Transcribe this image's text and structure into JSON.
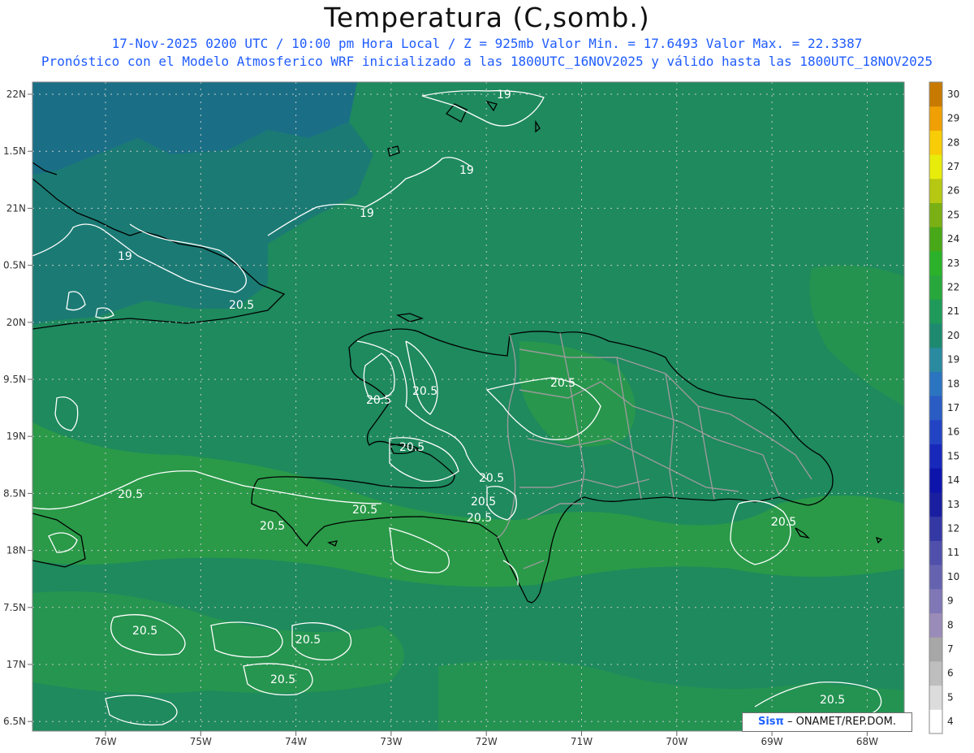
{
  "header": {
    "title": "Temperatura (C,somb.)",
    "line1": "17-Nov-2025  0200 UTC / 10:00 pm Hora Local / Z = 925mb   Valor Min. = 17.6493  Valor Max. = 22.3387",
    "line2": "Pronóstico con el Modelo Atmosferico WRF inicializado a las 1800UTC_16NOV2025 y válido hasta las  1800UTC_18NOV2025"
  },
  "map": {
    "lat_labels": [
      "22N",
      "1.5N",
      "21N",
      "0.5N",
      "20N",
      "9.5N",
      "19N",
      "8.5N",
      "18N",
      "7.5N",
      "17N",
      "6.5N"
    ],
    "lon_labels": [
      "76W",
      "75W",
      "74W",
      "73W",
      "72W",
      "71W",
      "70W",
      "69W",
      "68W"
    ],
    "contour_labels": [
      "19",
      "19",
      "19",
      "19",
      "20.5",
      "20.5",
      "20.5",
      "20.5",
      "20.5",
      "20.5",
      "20.5",
      "20.5",
      "20.5",
      "20.5",
      "20.5",
      "20.5",
      "20.5",
      "20.5",
      "20.5",
      "20.5"
    ],
    "colors": {
      "background_field": "#1e8a5e",
      "cold_region": "#1a6f86",
      "warm_region": "#2a9a48",
      "contour": "#ffffff",
      "coastline": "#000000",
      "borders": "#9a9a9a"
    }
  },
  "colorbar": {
    "levels": [
      "4",
      "5",
      "6",
      "7",
      "8",
      "9",
      "10",
      "11",
      "12",
      "13",
      "14",
      "15",
      "16",
      "17",
      "18",
      "19",
      "20",
      "21",
      "22",
      "23",
      "24",
      "25",
      "26",
      "27",
      "28",
      "29",
      "30"
    ],
    "colors": [
      "#ffffff",
      "#dcdcdc",
      "#bebebe",
      "#a7a7a7",
      "#9a8cb8",
      "#7f77b6",
      "#6563b0",
      "#5050ac",
      "#3438a4",
      "#1a1ea0",
      "#0d14ab",
      "#1828bb",
      "#2244c4",
      "#2a5cc4",
      "#2b74c0",
      "#2a8aa0",
      "#1d8a70",
      "#1f9a5a",
      "#28a83c",
      "#2bb22a",
      "#49a818",
      "#7ab014",
      "#b6c811",
      "#e8ec0a",
      "#f8cc06",
      "#f0a004",
      "#c87a00"
    ]
  },
  "footer": {
    "logo": "Sisπ",
    "org": "– ONAMET/REP.DOM."
  }
}
